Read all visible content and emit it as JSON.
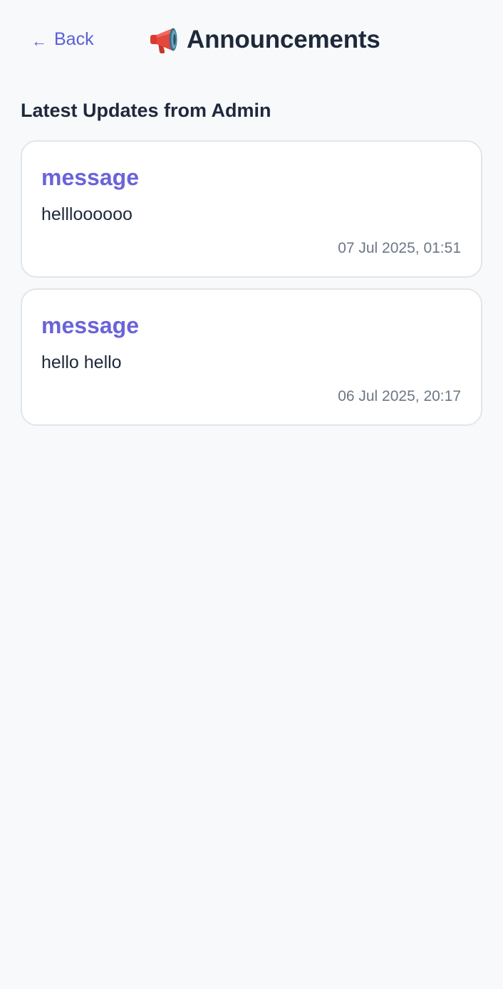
{
  "header": {
    "back_label": "Back",
    "back_arrow": "←",
    "title": "Announcements",
    "title_icon": "megaphone-icon"
  },
  "section": {
    "heading": "Latest Updates from Admin"
  },
  "announcements": [
    {
      "title": "message",
      "body": "hellloooooo",
      "timestamp": "07 Jul 2025, 01:51"
    },
    {
      "title": "message",
      "body": "hello hello",
      "timestamp": "06 Jul 2025, 20:17"
    }
  ],
  "colors": {
    "background": "#f7f9fb",
    "accent": "#5b5fd6",
    "card_title": "#6a63d9",
    "text": "#1e293b",
    "muted": "#6b7787",
    "card_border": "#e2e6ea"
  }
}
